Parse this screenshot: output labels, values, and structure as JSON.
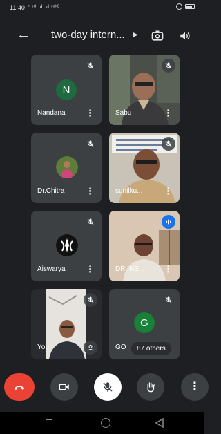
{
  "status_bar": {
    "time": "11:40",
    "network": "⁰ ᵒᵗᴵ .ıl .ıl ᵛᵒˡᵗᴱ"
  },
  "header": {
    "meeting_title": "two-day intern..."
  },
  "participants": [
    {
      "name": "Nandana",
      "initial": "N",
      "avatar_color": "#1e6b3f",
      "muted": true
    },
    {
      "name": "Sabu",
      "muted": true
    },
    {
      "name": "Dr.Chitra",
      "muted": true
    },
    {
      "name": "sunilku...",
      "muted": true
    },
    {
      "name": "Aiswarya",
      "muted": true
    },
    {
      "name": "DR. NE...",
      "muted": false,
      "speaking": true
    },
    {
      "name": "You",
      "muted": true
    },
    {
      "name": "GO",
      "initial": "G",
      "avatar_color": "#188038",
      "muted": true,
      "others_label": "87 others"
    }
  ],
  "controls": [
    "end-call",
    "camera",
    "microphone",
    "raise-hand",
    "more-options"
  ],
  "colors": {
    "end_call": "#ea4335",
    "tile_bg": "#3c4043",
    "speaking_badge": "#1a73e8"
  }
}
